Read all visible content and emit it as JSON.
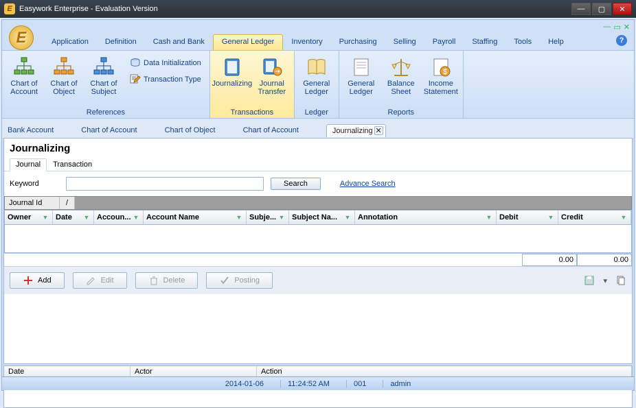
{
  "window": {
    "title": "Easywork Enterprise - Evaluation Version"
  },
  "menu": {
    "application": "Application",
    "definition": "Definition",
    "cashbank": "Cash and Bank",
    "general_ledger": "General Ledger",
    "inventory": "Inventory",
    "purchasing": "Purchasing",
    "selling": "Selling",
    "payroll": "Payroll",
    "staffing": "Staffing",
    "tools": "Tools",
    "help": "Help"
  },
  "ribbon": {
    "references": {
      "label": "References",
      "chart_account": "Chart of Account",
      "chart_object": "Chart of Object",
      "chart_subject": "Chart of Subject",
      "data_init": "Data Initialization",
      "trx_type": "Transaction Type"
    },
    "transactions": {
      "label": "Transactions",
      "journalizing": "Journalizing",
      "journal_transfer": "Journal Transfer"
    },
    "ledger": {
      "label": "Ledger",
      "general_ledger": "General Ledger"
    },
    "reports": {
      "label": "Reports",
      "general_ledger": "General Ledger",
      "balance_sheet": "Balance Sheet",
      "income_statement": "Income Statement"
    }
  },
  "tabs": {
    "bank_account": "Bank Account",
    "chart_account": "Chart of Account",
    "chart_object": "Chart of Object",
    "chart_account2": "Chart of Account",
    "journalizing": "Journalizing"
  },
  "page": {
    "title": "Journalizing",
    "subtab_journal": "Journal",
    "subtab_transaction": "Transaction",
    "keyword_label": "Keyword",
    "search_btn": "Search",
    "advance_search": "Advance Search"
  },
  "group": {
    "journal_id": "Journal Id",
    "slash": "/"
  },
  "columns": {
    "owner": "Owner",
    "date": "Date",
    "account": "Accoun...",
    "account_name": "Account Name",
    "subject": "Subje...",
    "subject_name": "Subject Na...",
    "annotation": "Annotation",
    "debit": "Debit",
    "credit": "Credit"
  },
  "totals": {
    "debit": "0.00",
    "credit": "0.00"
  },
  "actions": {
    "add": "Add",
    "edit": "Edit",
    "delete": "Delete",
    "posting": "Posting"
  },
  "log": {
    "date": "Date",
    "actor": "Actor",
    "action": "Action"
  },
  "status": {
    "date": "2014-01-06",
    "time": "11:24:52 AM",
    "code": "001",
    "user": "admin"
  }
}
